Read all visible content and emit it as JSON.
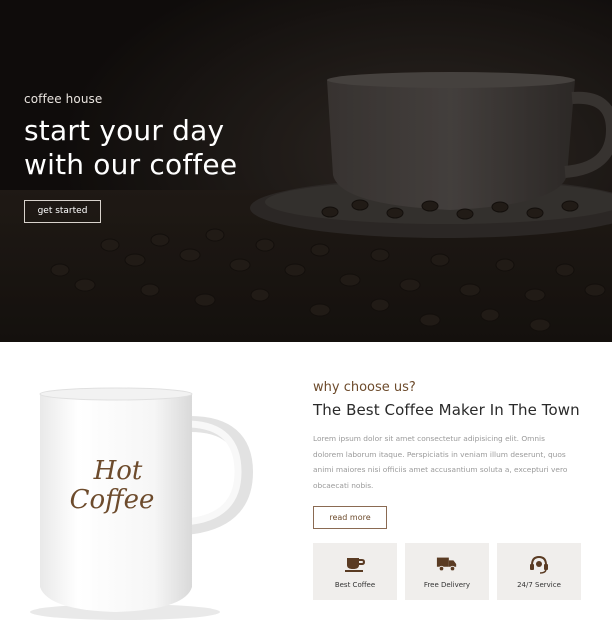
{
  "hero": {
    "eyebrow": "coffee house",
    "headline_line1": "start your day",
    "headline_line2": "with our coffee",
    "cta_label": "get started"
  },
  "about": {
    "mug_text_line1": "Hot",
    "mug_text_line2": "Coffee",
    "kicker": "why choose us?",
    "title": "The Best Coffee Maker In The Town",
    "body": "Lorem ipsum dolor sit amet consectetur adipisicing elit. Omnis dolorem laborum itaque. Perspiciatis in veniam illum deserunt, quos animi maiores nisi officiis amet accusantium soluta a, excepturi vero obcaecati nobis.",
    "readmore_label": "read more",
    "features": [
      {
        "label": "Best Coffee",
        "icon": "coffee-cup-icon"
      },
      {
        "label": "Free Delivery",
        "icon": "delivery-truck-icon"
      },
      {
        "label": "24/7 Service",
        "icon": "headset-icon"
      }
    ]
  },
  "colors": {
    "hero_bg": "#1a1512",
    "accent": "#6d4b2c",
    "feature_bg": "#f0eeec",
    "body_text": "#9a9a9a"
  }
}
